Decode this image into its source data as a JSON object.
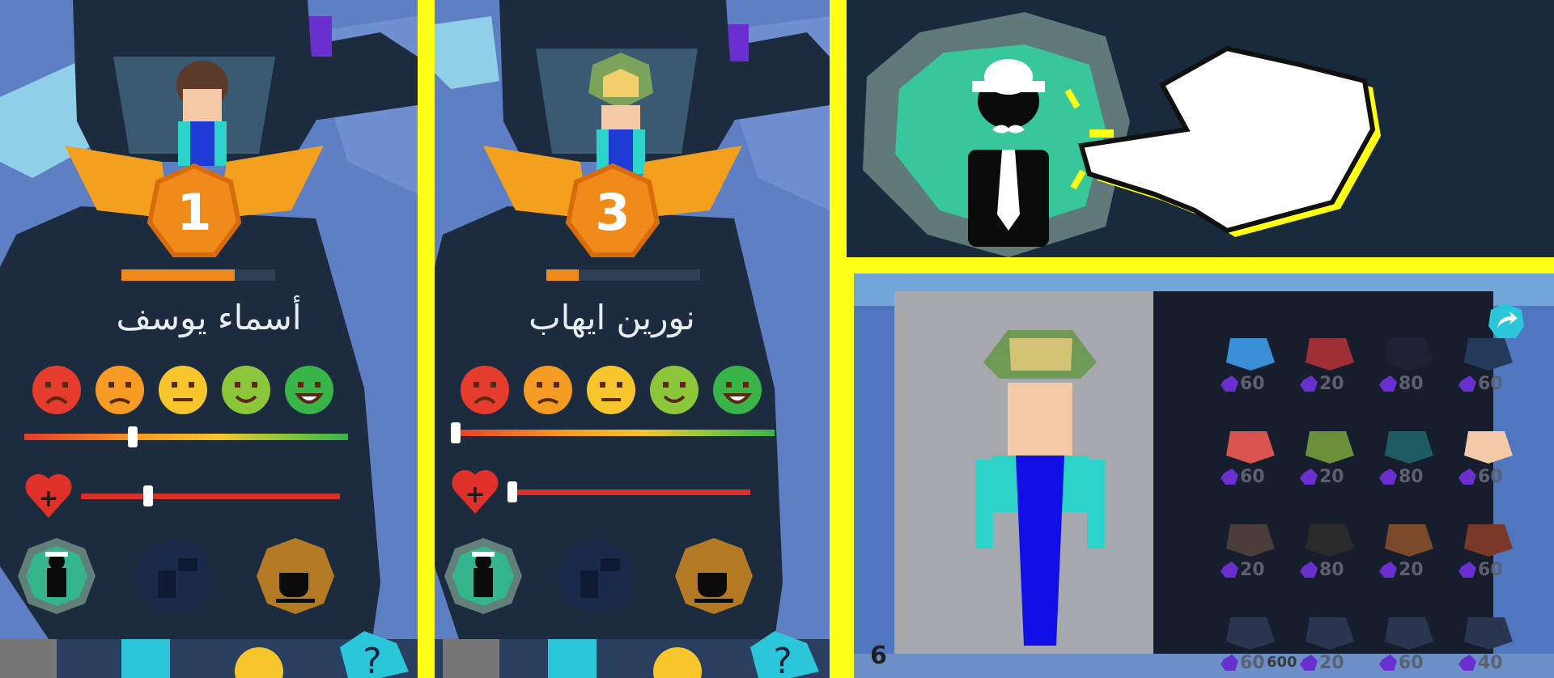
{
  "panels": [
    {
      "rank": "1",
      "name": "أسماء يوسف",
      "mood_level": 0.33,
      "health_level": 0.25
    },
    {
      "rank": "3",
      "name": "نورين ايهاب",
      "mood_level": 0.0,
      "health_level": 0.0
    }
  ],
  "moods": [
    "angry-face-icon",
    "sad-face-icon",
    "neutral-face-icon",
    "smile-face-icon",
    "grin-face-icon"
  ],
  "mood_colors": [
    "#e53c2e",
    "#f59a22",
    "#f7c52c",
    "#8cc63a",
    "#38b449"
  ],
  "action_buttons": [
    "outfit-button",
    "chat-button",
    "coffee-button"
  ],
  "shop": {
    "prices": [
      "60",
      "20",
      "80",
      "60",
      "60",
      "20",
      "80",
      "60",
      "20",
      "80",
      "20",
      "60",
      "60",
      "20",
      "60",
      "40"
    ],
    "hud_counter": "6",
    "bottom_value": "600"
  },
  "colors": {
    "gem": "#6a2fcf",
    "panel_dark": "#1d2b3f",
    "wing": "#f2a01d",
    "badge": "#f08a1a",
    "accent_green": "#36c49a",
    "highlight_yellow": "#ffff18"
  }
}
